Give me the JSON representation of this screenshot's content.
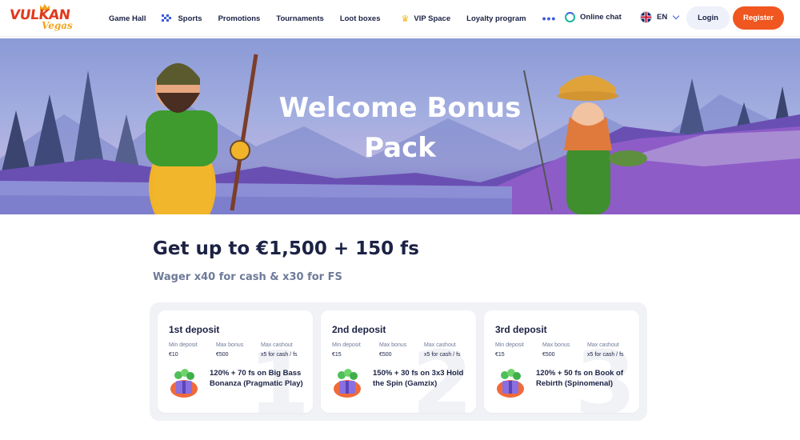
{
  "header": {
    "logo": {
      "line1": "VULKAN",
      "line2": "Vegas"
    },
    "nav": [
      {
        "label": "Game Hall",
        "icon": ""
      },
      {
        "label": "Sports",
        "icon": "checkered-icon"
      },
      {
        "label": "Promotions",
        "icon": ""
      },
      {
        "label": "Tournaments",
        "icon": ""
      },
      {
        "label": "Loot boxes",
        "icon": ""
      },
      {
        "label": "VIP Space",
        "icon": "crown-icon"
      },
      {
        "label": "Loyalty program",
        "icon": ""
      }
    ],
    "more_icon": "more-dots-icon",
    "chat_label": "Online chat",
    "lang_label": "EN",
    "login_label": "Login",
    "register_label": "Register"
  },
  "hero": {
    "title": "Welcome Bonus Pack"
  },
  "bonus": {
    "headline": "Get up to €1,500 + 150 fs",
    "subline": "Wager x40 for cash & x30 for FS",
    "cards": [
      {
        "title": "1st deposit",
        "number": "1",
        "min_label": "Min deposit",
        "min_value": "€10",
        "max_label": "Max bonus",
        "max_value": "€500",
        "cash_label": "Max cashout",
        "cash_value": "x5 for cash / fs",
        "offer": "120% + 70 fs on Big Bass Bonanza (Pragmatic Play)"
      },
      {
        "title": "2nd deposit",
        "number": "2",
        "min_label": "Min deposit",
        "min_value": "€15",
        "max_label": "Max bonus",
        "max_value": "€500",
        "cash_label": "Max cashout",
        "cash_value": "x5 for cash / fs",
        "offer": "150% + 30 fs on 3x3 Hold the Spin (Gamzix)"
      },
      {
        "title": "3rd deposit",
        "number": "3",
        "min_label": "Min deposit",
        "min_value": "€15",
        "max_label": "Max bonus",
        "max_value": "€500",
        "cash_label": "Max cashout",
        "cash_value": "x5 for cash / fs",
        "offer": "120% + 50 fs on Book of Rebirth (Spinomenal)"
      }
    ]
  },
  "colors": {
    "accent": "#f0561f",
    "text_dark": "#1b2244",
    "text_muted": "#6e7a99",
    "link_blue": "#3b5bdb"
  }
}
